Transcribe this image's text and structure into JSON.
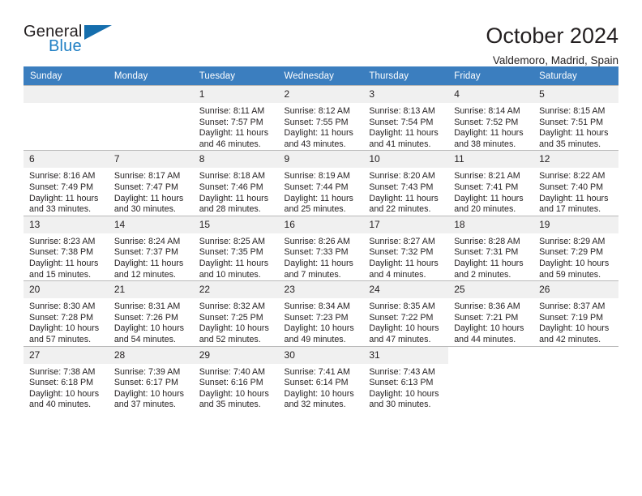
{
  "brand": {
    "name_part1": "General",
    "name_part2": "Blue",
    "logo_icon": "triangle-logo-icon",
    "accent_color": "#1f7fc4"
  },
  "header": {
    "month_title": "October 2024",
    "location": "Valdemoro, Madrid, Spain"
  },
  "calendar": {
    "header_bg": "#3b7ebf",
    "daynum_bg": "#f0f0f0",
    "weekdays": [
      "Sunday",
      "Monday",
      "Tuesday",
      "Wednesday",
      "Thursday",
      "Friday",
      "Saturday"
    ],
    "weeks": [
      [
        {
          "day": "",
          "empty": true
        },
        {
          "day": "",
          "empty": true
        },
        {
          "day": "1",
          "sunrise": "Sunrise: 8:11 AM",
          "sunset": "Sunset: 7:57 PM",
          "daylight": "Daylight: 11 hours and 46 minutes."
        },
        {
          "day": "2",
          "sunrise": "Sunrise: 8:12 AM",
          "sunset": "Sunset: 7:55 PM",
          "daylight": "Daylight: 11 hours and 43 minutes."
        },
        {
          "day": "3",
          "sunrise": "Sunrise: 8:13 AM",
          "sunset": "Sunset: 7:54 PM",
          "daylight": "Daylight: 11 hours and 41 minutes."
        },
        {
          "day": "4",
          "sunrise": "Sunrise: 8:14 AM",
          "sunset": "Sunset: 7:52 PM",
          "daylight": "Daylight: 11 hours and 38 minutes."
        },
        {
          "day": "5",
          "sunrise": "Sunrise: 8:15 AM",
          "sunset": "Sunset: 7:51 PM",
          "daylight": "Daylight: 11 hours and 35 minutes."
        }
      ],
      [
        {
          "day": "6",
          "sunrise": "Sunrise: 8:16 AM",
          "sunset": "Sunset: 7:49 PM",
          "daylight": "Daylight: 11 hours and 33 minutes."
        },
        {
          "day": "7",
          "sunrise": "Sunrise: 8:17 AM",
          "sunset": "Sunset: 7:47 PM",
          "daylight": "Daylight: 11 hours and 30 minutes."
        },
        {
          "day": "8",
          "sunrise": "Sunrise: 8:18 AM",
          "sunset": "Sunset: 7:46 PM",
          "daylight": "Daylight: 11 hours and 28 minutes."
        },
        {
          "day": "9",
          "sunrise": "Sunrise: 8:19 AM",
          "sunset": "Sunset: 7:44 PM",
          "daylight": "Daylight: 11 hours and 25 minutes."
        },
        {
          "day": "10",
          "sunrise": "Sunrise: 8:20 AM",
          "sunset": "Sunset: 7:43 PM",
          "daylight": "Daylight: 11 hours and 22 minutes."
        },
        {
          "day": "11",
          "sunrise": "Sunrise: 8:21 AM",
          "sunset": "Sunset: 7:41 PM",
          "daylight": "Daylight: 11 hours and 20 minutes."
        },
        {
          "day": "12",
          "sunrise": "Sunrise: 8:22 AM",
          "sunset": "Sunset: 7:40 PM",
          "daylight": "Daylight: 11 hours and 17 minutes."
        }
      ],
      [
        {
          "day": "13",
          "sunrise": "Sunrise: 8:23 AM",
          "sunset": "Sunset: 7:38 PM",
          "daylight": "Daylight: 11 hours and 15 minutes."
        },
        {
          "day": "14",
          "sunrise": "Sunrise: 8:24 AM",
          "sunset": "Sunset: 7:37 PM",
          "daylight": "Daylight: 11 hours and 12 minutes."
        },
        {
          "day": "15",
          "sunrise": "Sunrise: 8:25 AM",
          "sunset": "Sunset: 7:35 PM",
          "daylight": "Daylight: 11 hours and 10 minutes."
        },
        {
          "day": "16",
          "sunrise": "Sunrise: 8:26 AM",
          "sunset": "Sunset: 7:33 PM",
          "daylight": "Daylight: 11 hours and 7 minutes."
        },
        {
          "day": "17",
          "sunrise": "Sunrise: 8:27 AM",
          "sunset": "Sunset: 7:32 PM",
          "daylight": "Daylight: 11 hours and 4 minutes."
        },
        {
          "day": "18",
          "sunrise": "Sunrise: 8:28 AM",
          "sunset": "Sunset: 7:31 PM",
          "daylight": "Daylight: 11 hours and 2 minutes."
        },
        {
          "day": "19",
          "sunrise": "Sunrise: 8:29 AM",
          "sunset": "Sunset: 7:29 PM",
          "daylight": "Daylight: 10 hours and 59 minutes."
        }
      ],
      [
        {
          "day": "20",
          "sunrise": "Sunrise: 8:30 AM",
          "sunset": "Sunset: 7:28 PM",
          "daylight": "Daylight: 10 hours and 57 minutes."
        },
        {
          "day": "21",
          "sunrise": "Sunrise: 8:31 AM",
          "sunset": "Sunset: 7:26 PM",
          "daylight": "Daylight: 10 hours and 54 minutes."
        },
        {
          "day": "22",
          "sunrise": "Sunrise: 8:32 AM",
          "sunset": "Sunset: 7:25 PM",
          "daylight": "Daylight: 10 hours and 52 minutes."
        },
        {
          "day": "23",
          "sunrise": "Sunrise: 8:34 AM",
          "sunset": "Sunset: 7:23 PM",
          "daylight": "Daylight: 10 hours and 49 minutes."
        },
        {
          "day": "24",
          "sunrise": "Sunrise: 8:35 AM",
          "sunset": "Sunset: 7:22 PM",
          "daylight": "Daylight: 10 hours and 47 minutes."
        },
        {
          "day": "25",
          "sunrise": "Sunrise: 8:36 AM",
          "sunset": "Sunset: 7:21 PM",
          "daylight": "Daylight: 10 hours and 44 minutes."
        },
        {
          "day": "26",
          "sunrise": "Sunrise: 8:37 AM",
          "sunset": "Sunset: 7:19 PM",
          "daylight": "Daylight: 10 hours and 42 minutes."
        }
      ],
      [
        {
          "day": "27",
          "sunrise": "Sunrise: 7:38 AM",
          "sunset": "Sunset: 6:18 PM",
          "daylight": "Daylight: 10 hours and 40 minutes."
        },
        {
          "day": "28",
          "sunrise": "Sunrise: 7:39 AM",
          "sunset": "Sunset: 6:17 PM",
          "daylight": "Daylight: 10 hours and 37 minutes."
        },
        {
          "day": "29",
          "sunrise": "Sunrise: 7:40 AM",
          "sunset": "Sunset: 6:16 PM",
          "daylight": "Daylight: 10 hours and 35 minutes."
        },
        {
          "day": "30",
          "sunrise": "Sunrise: 7:41 AM",
          "sunset": "Sunset: 6:14 PM",
          "daylight": "Daylight: 10 hours and 32 minutes."
        },
        {
          "day": "31",
          "sunrise": "Sunrise: 7:43 AM",
          "sunset": "Sunset: 6:13 PM",
          "daylight": "Daylight: 10 hours and 30 minutes."
        },
        {
          "day": "",
          "blank": true
        },
        {
          "day": "",
          "blank": true
        }
      ]
    ]
  }
}
